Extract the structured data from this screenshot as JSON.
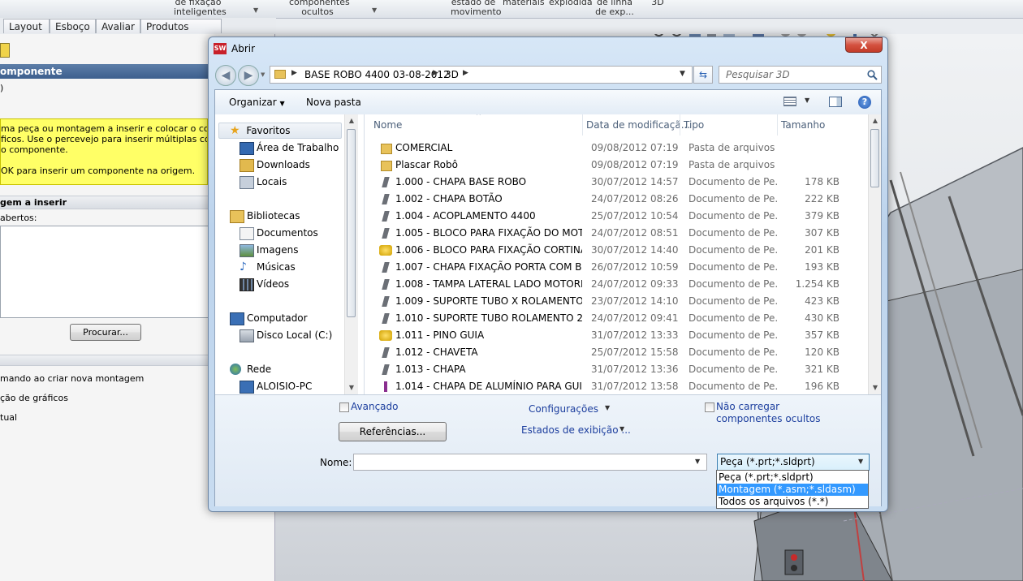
{
  "app": {
    "ribbon_labels": [
      "de fixação\ninteligentes",
      "componentes\nocultos",
      "estado de\nmovimento",
      "materiais",
      "explodida",
      "de linha\nde exp...",
      "3D"
    ],
    "tabs": [
      "Layout",
      "Esboço",
      "Avaliar",
      "Produtos Office"
    ],
    "left_panel": {
      "header": "omponente",
      "message_text": "ma peça ou montagem a inserir e colocar o compo\nficos. Use o percevejo para inserir múltiplas cópias\no componente.\n\nOK para inserir um componente na origem.",
      "section_insert": "gem a inserir",
      "open_label": " abertos:",
      "browse_button": "Procurar...",
      "options": [
        "mando ao criar nova montagem",
        "ção de gráficos",
        "tual"
      ]
    }
  },
  "dialog": {
    "title": "Abrir",
    "close_label": "X",
    "breadcrumb": [
      "BASE ROBO 4400 03-08-2012",
      "3D"
    ],
    "search_placeholder": "Pesquisar 3D",
    "toolbar": {
      "organize": "Organizar",
      "new_folder": "Nova pasta"
    },
    "nav": {
      "favorites": "Favoritos",
      "favorites_items": [
        "Área de Trabalho",
        "Downloads",
        "Locais"
      ],
      "libraries": "Bibliotecas",
      "libraries_items": [
        "Documentos",
        "Imagens",
        "Músicas",
        "Vídeos"
      ],
      "computer": "Computador",
      "computer_items": [
        "Disco Local (C:)"
      ],
      "network": "Rede",
      "network_items": [
        "ALOISIO-PC"
      ]
    },
    "columns": {
      "name": "Nome",
      "date": "Data de modificaçã...",
      "type": "Tipo",
      "size": "Tamanho"
    },
    "files": [
      {
        "name": "COMERCIAL",
        "date": "09/08/2012 07:19",
        "type": "Pasta de arquivos",
        "size": "",
        "kind": "folder"
      },
      {
        "name": "Plascar Robô",
        "date": "09/08/2012 07:19",
        "type": "Pasta de arquivos",
        "size": "",
        "kind": "folder"
      },
      {
        "name": "1.000 - CHAPA BASE ROBO",
        "date": "30/07/2012 14:57",
        "type": "Documento de Pe...",
        "size": "178 KB",
        "kind": "part"
      },
      {
        "name": "1.002 - CHAPA BOTÃO",
        "date": "24/07/2012 08:26",
        "type": "Documento de Pe...",
        "size": "222 KB",
        "kind": "part"
      },
      {
        "name": "1.004 - ACOPLAMENTO 4400",
        "date": "25/07/2012 10:54",
        "type": "Documento de Pe...",
        "size": "379 KB",
        "kind": "part"
      },
      {
        "name": "1.005 - BLOCO PARA FIXAÇÃO DO MOT...",
        "date": "24/07/2012 08:51",
        "type": "Documento de Pe...",
        "size": "307 KB",
        "kind": "part"
      },
      {
        "name": "1.006 - BLOCO PARA FIXAÇÃO CORTINA",
        "date": "30/07/2012 14:40",
        "type": "Documento de Pe...",
        "size": "201 KB",
        "kind": "part-yellow"
      },
      {
        "name": "1.007 - CHAPA FIXAÇÃO PORTA COM B...",
        "date": "26/07/2012 10:59",
        "type": "Documento de Pe...",
        "size": "193 KB",
        "kind": "part"
      },
      {
        "name": "1.008 - TAMPA LATERAL LADO MOTORE...",
        "date": "24/07/2012 09:33",
        "type": "Documento de Pe...",
        "size": "1.254 KB",
        "kind": "part"
      },
      {
        "name": "1.009 - SUPORTE TUBO X ROLAMENTO",
        "date": "23/07/2012 14:10",
        "type": "Documento de Pe...",
        "size": "423 KB",
        "kind": "part"
      },
      {
        "name": "1.010 - SUPORTE TUBO ROLAMENTO 2",
        "date": "24/07/2012 09:41",
        "type": "Documento de Pe...",
        "size": "430 KB",
        "kind": "part"
      },
      {
        "name": "1.011 - PINO GUIA",
        "date": "31/07/2012 13:33",
        "type": "Documento de Pe...",
        "size": "357 KB",
        "kind": "part-yellow"
      },
      {
        "name": "1.012 - CHAVETA",
        "date": "25/07/2012 15:58",
        "type": "Documento de Pe...",
        "size": "120 KB",
        "kind": "part"
      },
      {
        "name": "1.013 - CHAPA",
        "date": "31/07/2012 13:36",
        "type": "Documento de Pe...",
        "size": "321 KB",
        "kind": "part"
      },
      {
        "name": "1.014 - CHAPA DE ALUMÍNIO PARA GUIA",
        "date": "31/07/2012 13:58",
        "type": "Documento de Pe...",
        "size": "196 KB",
        "kind": "part-purple"
      }
    ],
    "options": {
      "advanced": "Avançado",
      "references_button": "Referências...",
      "configurations": "Configurações",
      "display_states": "Estados de exibição ...",
      "no_hidden_line1": "Não carregar",
      "no_hidden_line2": "componentes ocultos"
    },
    "filename_label": "Nome:",
    "filename_value": "",
    "filetype_selected": "Peça (*.prt;*.sldprt)",
    "filetype_options": [
      "Peça (*.prt;*.sldprt)",
      "Montagem (*.asm;*.sldasm)",
      "Todos os arquivos (*.*)"
    ],
    "filetype_highlighted_index": 1
  },
  "colors": {
    "highlight": "#3399ff",
    "message_bg": "#ffff66",
    "close_red": "#c8412e",
    "link": "#1c3e9e"
  }
}
